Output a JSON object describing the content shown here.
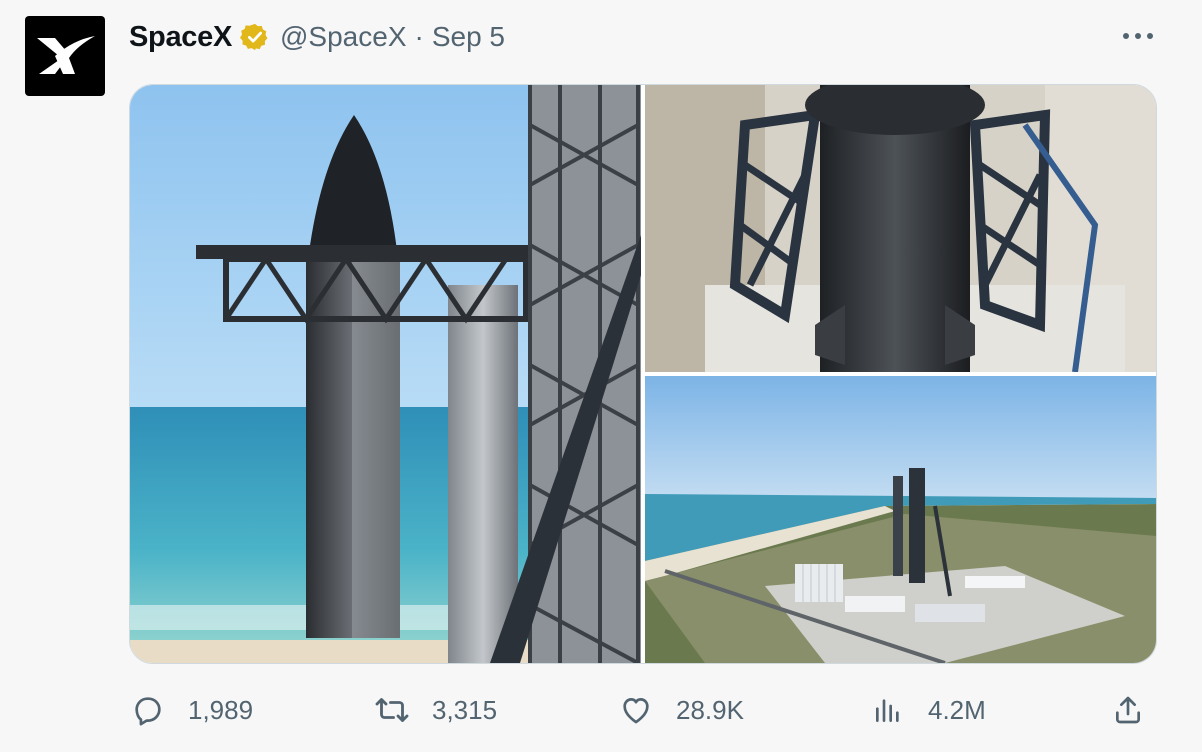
{
  "tweet": {
    "author_name": "SpaceX",
    "author_handle": "@SpaceX",
    "separator": "·",
    "date": "Sep 5",
    "avatar_icon": "spacex-x-logo-icon",
    "verified_icon": "verified-badge-icon",
    "verified_color": "#e2b719",
    "more_icon": "more-options-icon"
  },
  "media": {
    "photos": [
      {
        "name": "starship-on-launch-tower-photo"
      },
      {
        "name": "aerial-booster-chopsticks-photo"
      },
      {
        "name": "starbase-coastline-aerial-photo"
      }
    ]
  },
  "actions": {
    "reply": {
      "icon": "reply-icon",
      "count": "1,989"
    },
    "retweet": {
      "icon": "retweet-icon",
      "count": "3,315"
    },
    "like": {
      "icon": "heart-icon",
      "count": "28.9K"
    },
    "views": {
      "icon": "views-chart-icon",
      "count": "4.2M"
    },
    "share": {
      "icon": "share-icon"
    }
  },
  "colors": {
    "text_primary": "#0f1419",
    "text_secondary": "#536471",
    "background": "#f7f7f7"
  }
}
